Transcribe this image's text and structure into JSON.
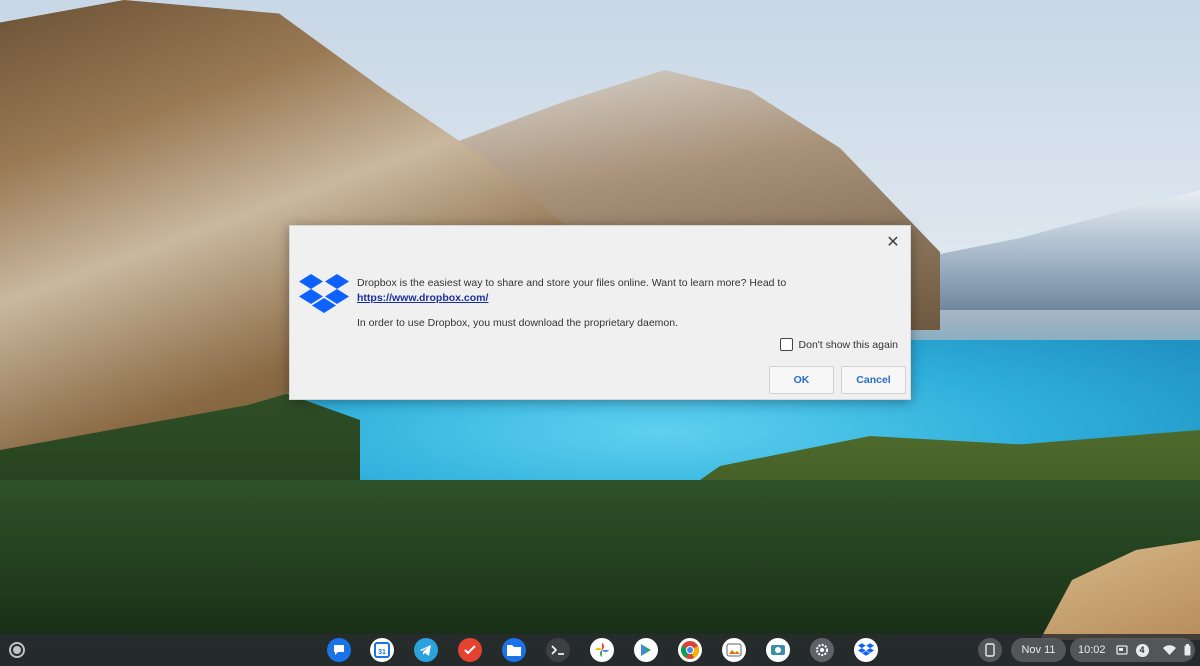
{
  "dialog": {
    "message_line1_prefix": "Dropbox is the easiest way to share and store your files online. Want to learn more? Head to ",
    "message_link": "https://www.dropbox.com/",
    "message_line2": "In order to use Dropbox, you must download the proprietary daemon.",
    "checkbox_label": "Don't show this again",
    "checkbox_checked": false,
    "ok_label": "OK",
    "cancel_label": "Cancel",
    "close_symbol": "✕"
  },
  "shelf": {
    "apps": [
      {
        "name": "google-messages-icon",
        "color": "#1a73e8",
        "glyph": "💬"
      },
      {
        "name": "google-calendar-icon",
        "color": "#ffffff",
        "glyph": "31"
      },
      {
        "name": "telegram-icon",
        "color": "#2aa3dd",
        "glyph": "➤"
      },
      {
        "name": "todoist-icon",
        "color": "#e44332",
        "glyph": "✓"
      },
      {
        "name": "files-icon",
        "color": "#1a73e8",
        "glyph": "▤"
      },
      {
        "name": "terminal-icon",
        "color": "#3c4043",
        "glyph": ">_"
      },
      {
        "name": "google-photos-icon",
        "color": "#ffffff",
        "glyph": "✿"
      },
      {
        "name": "play-store-icon",
        "color": "#ffffff",
        "glyph": "▶"
      },
      {
        "name": "chrome-icon",
        "color": "#ffffff",
        "glyph": "◉"
      },
      {
        "name": "gallery-icon",
        "color": "#ffffff",
        "glyph": "▣"
      },
      {
        "name": "camera-icon",
        "color": "#ffffff",
        "glyph": "◙"
      },
      {
        "name": "settings-icon",
        "color": "#5f6368",
        "glyph": "⚙"
      },
      {
        "name": "dropbox-icon",
        "color": "#ffffff",
        "glyph": "❖"
      }
    ],
    "date": "Nov 11",
    "time": "10:02",
    "notification_count": "4"
  }
}
